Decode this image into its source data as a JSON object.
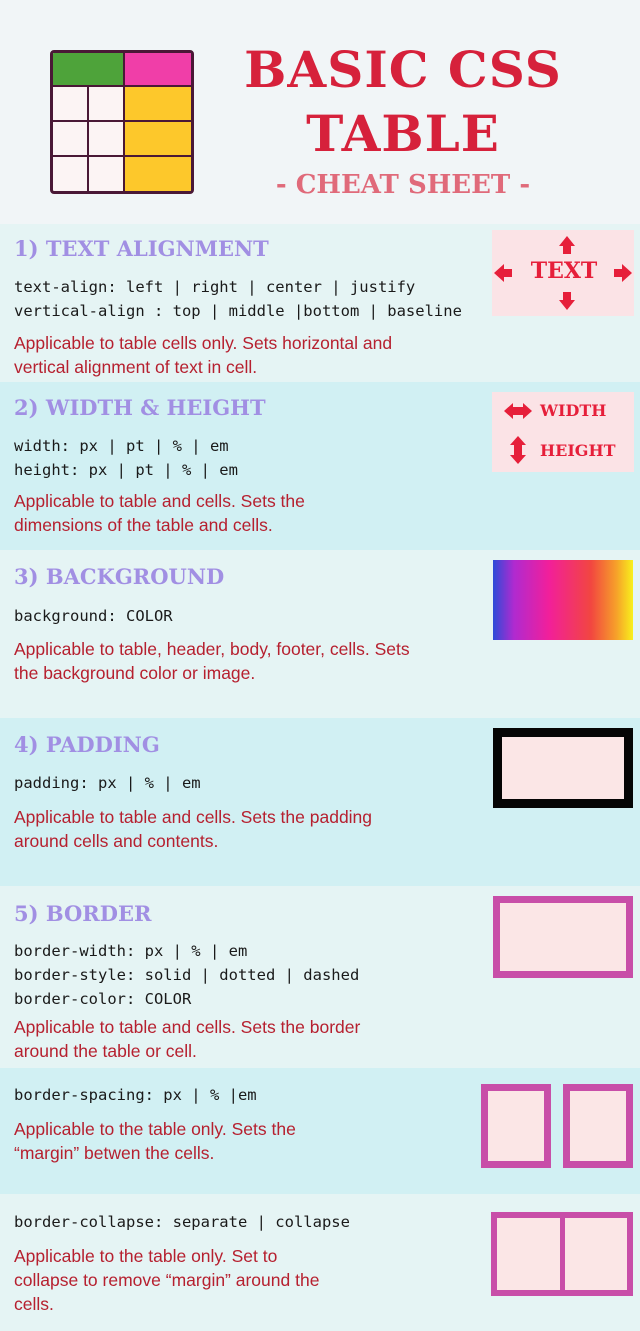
{
  "header": {
    "title_line1": "BASIC CSS",
    "title_line2": "TABLE",
    "subtitle": "- CHEAT SHEET -"
  },
  "colors": {
    "title": "#d6213b",
    "heading": "#a18fe3",
    "description": "#b6202f",
    "accent_red": "#e61f3a",
    "border_magenta": "#c84ea8"
  },
  "icons": {
    "text_icon_label": "TEXT",
    "width_label": "WIDTH",
    "height_label": "HEIGHT"
  },
  "sections": [
    {
      "heading": "1) TEXT ALIGNMENT",
      "code": [
        "text-align: left | right | center | justify",
        "vertical-align : top | middle |bottom | baseline"
      ],
      "desc": "Applicable to table cells only. Sets horizontal and vertical alignment of text in cell."
    },
    {
      "heading": "2) WIDTH & HEIGHT",
      "code": [
        "width: px | pt | % | em",
        "height: px | pt | % | em"
      ],
      "desc": "Applicable to table and cells. Sets the dimensions of the table and cells."
    },
    {
      "heading": "3) BACKGROUND",
      "code": [
        "background: COLOR"
      ],
      "desc": "Applicable to table, header, body, footer, cells. Sets the background color or image."
    },
    {
      "heading": "4) PADDING",
      "code": [
        "padding: px | % | em"
      ],
      "desc": "Applicable to table and cells. Sets the padding around cells and contents."
    },
    {
      "heading": "5) BORDER",
      "code": [
        "border-width: px | % | em",
        "border-style: solid | dotted | dashed",
        "border-color: COLOR"
      ],
      "desc": "Applicable to table and cells. Sets the border around the table or cell."
    },
    {
      "heading": "",
      "code": [
        "border-spacing: px | % |em"
      ],
      "desc": "Applicable to the table only. Sets the “margin” betwen the cells."
    },
    {
      "heading": "",
      "code": [
        "border-collapse: separate | collapse"
      ],
      "desc": "Applicable to the table only. Set to collapse to remove “margin” around the cells."
    }
  ]
}
